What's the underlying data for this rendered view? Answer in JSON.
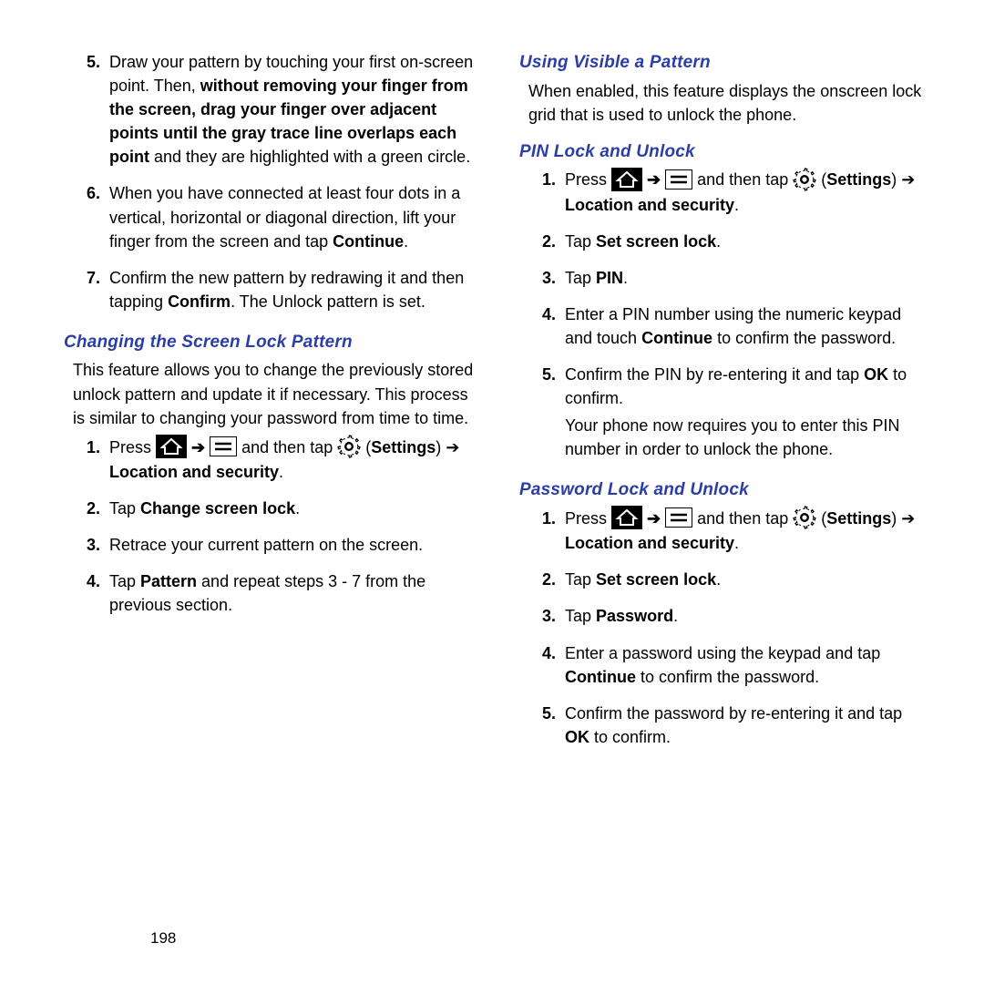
{
  "page_number": "198",
  "left": {
    "steps_a": [
      {
        "n": "5.",
        "html": "Draw your pattern by touching your first on-screen point. Then, <b>without removing your finger from the screen, drag your finger over adjacent points until the gray trace line overlaps each point</b> and they are highlighted with a green circle."
      },
      {
        "n": "6.",
        "html": "When you have connected at least four dots in a vertical, horizontal or diagonal direction, lift your finger from the screen and tap <b>Continue</b>."
      },
      {
        "n": "7.",
        "html": "Confirm the new pattern by redrawing it and then tapping <b>Confirm</b>. The Unlock pattern is set."
      }
    ],
    "heading1": "Changing the Screen Lock Pattern",
    "intro1": "This feature allows you to change the previously stored unlock pattern and update it if necessary. This process is similar to changing your password from time to time.",
    "steps_b": [
      {
        "n": "1.",
        "press": "Press ",
        "mid": " and then tap ",
        "tail_html": "(<b>Settings</b>) ➔ <b>Location and security</b>."
      },
      {
        "n": "2.",
        "html": "Tap <b>Change screen lock</b>."
      },
      {
        "n": "3.",
        "html": "Retrace your current pattern on the screen."
      },
      {
        "n": "4.",
        "html": "Tap <b>Pattern</b> and repeat steps 3 - 7 from the previous section."
      }
    ]
  },
  "right": {
    "heading1": "Using Visible a Pattern",
    "intro1": "When enabled, this feature displays the onscreen lock grid that is used to unlock the phone.",
    "heading2": "PIN Lock and Unlock",
    "steps_pin": [
      {
        "n": "1.",
        "press": "Press ",
        "mid": " and then tap ",
        "tail_html": "(<b>Settings</b>) ➔ <b>Location and security</b>."
      },
      {
        "n": "2.",
        "html": "Tap <b>Set screen lock</b>."
      },
      {
        "n": "3.",
        "html": "Tap <b>PIN</b>."
      },
      {
        "n": "4.",
        "html": "Enter a PIN number using the numeric keypad and touch <b>Continue</b> to confirm the password."
      },
      {
        "n": "5.",
        "html": "Confirm the PIN by re-entering it and tap <b>OK</b> to confirm.",
        "extra": "Your phone now requires you to enter this PIN number in order to unlock the phone."
      }
    ],
    "heading3": "Password Lock and Unlock",
    "steps_pw": [
      {
        "n": "1.",
        "press": "Press ",
        "mid": " and then tap ",
        "tail_html": "(<b>Settings</b>) ➔ <b>Location and security</b>."
      },
      {
        "n": "2.",
        "html": "Tap <b>Set screen lock</b>."
      },
      {
        "n": "3.",
        "html": "Tap <b>Password</b>."
      },
      {
        "n": "4.",
        "html": "Enter a password using the keypad and tap <b>Continue</b> to confirm the password."
      },
      {
        "n": "5.",
        "html": "Confirm the password by re-entering it and tap <b>OK</b> to confirm."
      }
    ]
  }
}
